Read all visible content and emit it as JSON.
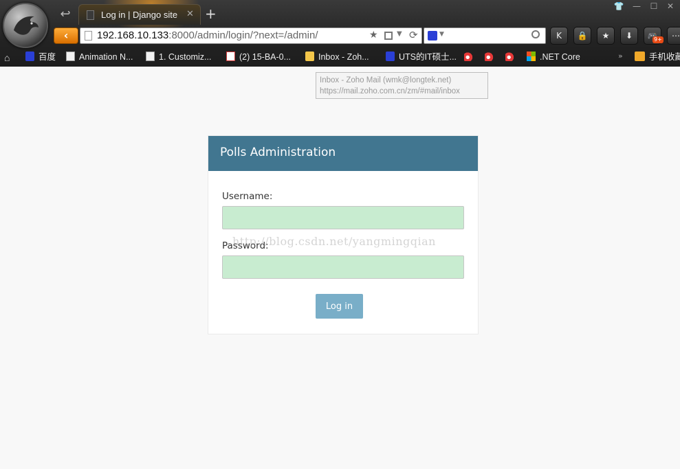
{
  "browser": {
    "tab_title": "Log in | Django site",
    "tab_close": "✕",
    "new_tab": "+",
    "address": {
      "host": "192.168.10.133",
      "rest": ":8000/admin/login/?next=/admin/"
    },
    "toolbar_buttons": [
      {
        "name": "k-extension-button",
        "glyph": "K"
      },
      {
        "name": "lock-button",
        "glyph": "🔒"
      },
      {
        "name": "favorites-button",
        "glyph": "★"
      },
      {
        "name": "download-button",
        "glyph": "⬇"
      },
      {
        "name": "game-button",
        "glyph": "🎮",
        "badge": "9+"
      },
      {
        "name": "menu-button",
        "glyph": "⋯"
      }
    ],
    "bookmarks": [
      {
        "icon": "home",
        "label": ""
      },
      {
        "icon": "paw",
        "label": "百度"
      },
      {
        "icon": "doc",
        "label": "Animation N..."
      },
      {
        "icon": "doc",
        "label": "1. Customiz..."
      },
      {
        "icon": "cal",
        "label": "(2) 15-BA-0..."
      },
      {
        "icon": "mail",
        "label": "Inbox - Zoh..."
      },
      {
        "icon": "paw",
        "label": "UTS的IT硕士..."
      },
      {
        "icon": "weibo",
        "label": ""
      },
      {
        "icon": "weibo",
        "label": ""
      },
      {
        "icon": "weibo",
        "label": ""
      },
      {
        "icon": "ms",
        "label": ".NET Core"
      }
    ],
    "bookmarks_more": "»",
    "bookmark_folder": "手机收藏"
  },
  "tooltip": {
    "line1": "Inbox - Zoho Mail (wmk@longtek.net)",
    "line2": "https://mail.zoho.com.cn/zm/#mail/inbox"
  },
  "login": {
    "header": "Polls Administration",
    "username_label": "Username:",
    "password_label": "Password:",
    "username_value": "",
    "password_value": "",
    "submit_label": "Log in"
  },
  "watermark": "http://blog.csdn.net/yangmingqian",
  "colors": {
    "header_bg": "#417690",
    "submit_bg": "#79aec8",
    "field_bg": "#c8ecd0",
    "page_bg": "#f8f8f8",
    "back_button": "#f08a1a"
  }
}
